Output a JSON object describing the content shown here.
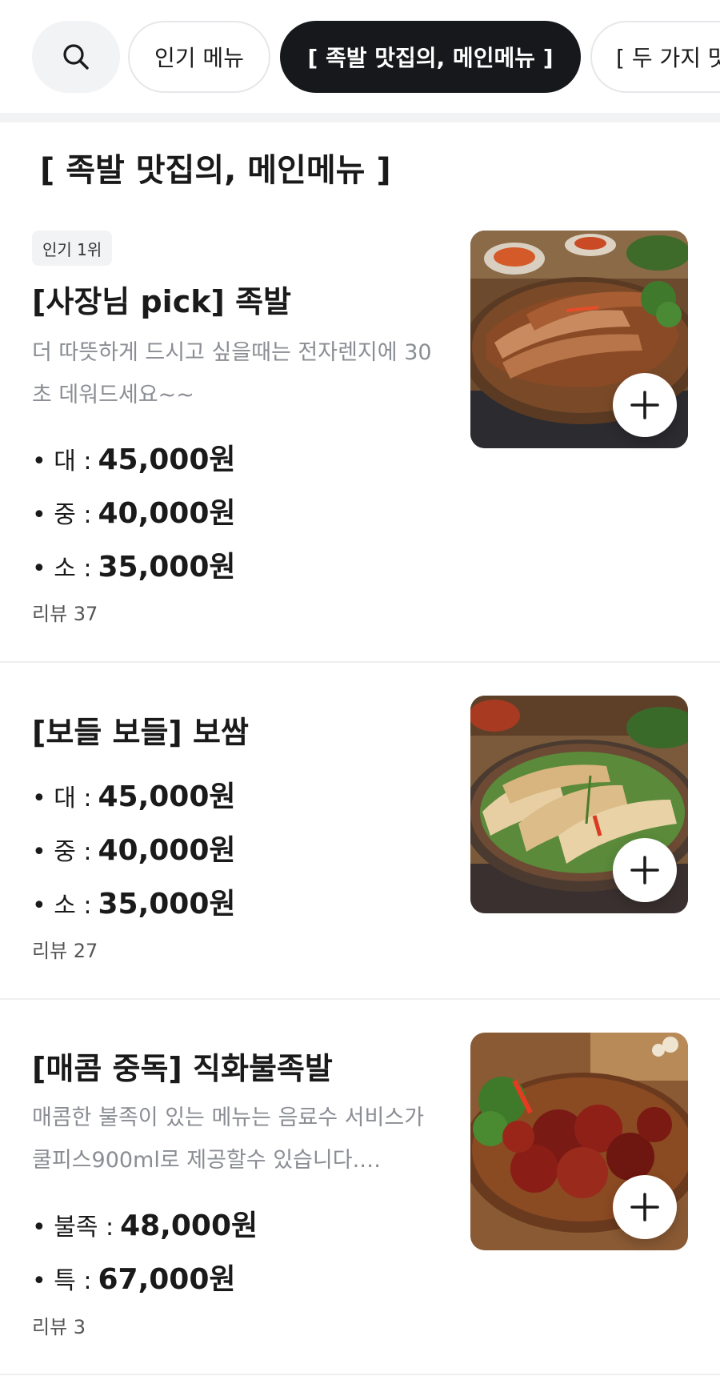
{
  "category_tabs": [
    {
      "label": "인기 메뉴"
    },
    {
      "label": "[ 족발 맛집의, 메인메뉴 ]",
      "active": true
    },
    {
      "label": "[ 두 가지 맛"
    }
  ],
  "section": {
    "title": "[ 족발 맛집의, 메인메뉴 ]"
  },
  "menu_items": [
    {
      "badge": "인기 1위",
      "name": "[사장님 pick] 족발",
      "description": "더 따뜻하게 드시고 싶을때는 전자렌지에 30초 데워드세요~~",
      "prices": [
        {
          "label": "• 대 :",
          "amount": "45,000원"
        },
        {
          "label": "• 중 :",
          "amount": "40,000원"
        },
        {
          "label": "• 소 :",
          "amount": "35,000원"
        }
      ],
      "review": "리뷰 37",
      "image": "jokbal-photo"
    },
    {
      "name": "[보들 보들] 보쌈",
      "prices": [
        {
          "label": "• 대 :",
          "amount": "45,000원"
        },
        {
          "label": "• 중 :",
          "amount": "40,000원"
        },
        {
          "label": "• 소 :",
          "amount": "35,000원"
        }
      ],
      "review": "리뷰 27",
      "image": "bossam-photo"
    },
    {
      "name": "[매콤 중독] 직화불족발",
      "description": "매콤한 불족이 있는 메뉴는 음료수 서비스가 쿨피스900ml로 제공할수 있습니다.…",
      "prices": [
        {
          "label": "• 불족 :",
          "amount": "48,000원"
        },
        {
          "label": "• 특 :",
          "amount": "67,000원"
        }
      ],
      "review": "리뷰 3",
      "image": "spicy-jokbal-photo"
    }
  ],
  "icons": {
    "search": "search-icon",
    "add": "plus-icon"
  },
  "colors": {
    "active_chip": "#16181b",
    "chip_bg": "#f2f3f5",
    "muted_text": "#8a8d93"
  }
}
